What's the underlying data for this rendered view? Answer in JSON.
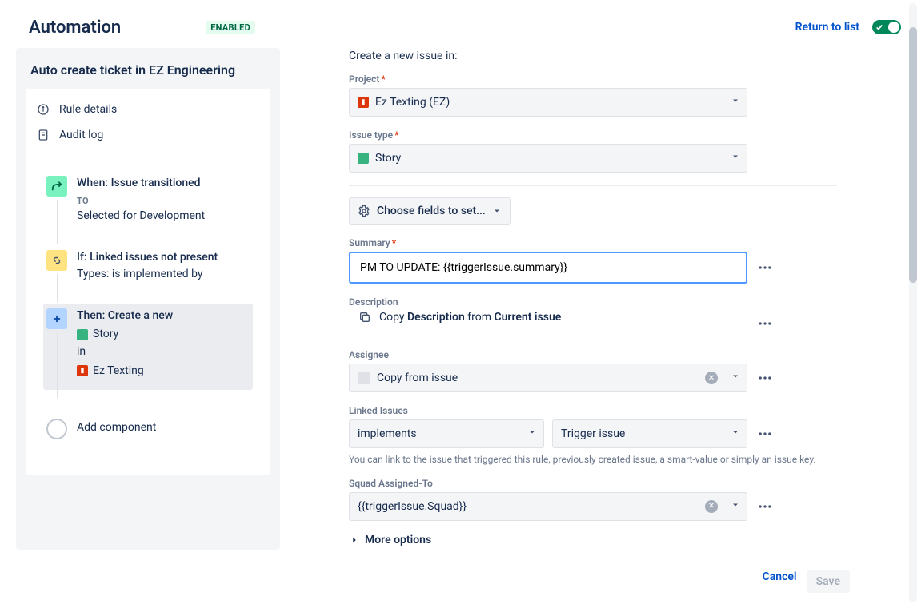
{
  "header": {
    "title": "Automation",
    "enabled_badge": "ENABLED",
    "return_label": "Return to list",
    "toggle_on": true
  },
  "rule": {
    "title": "Auto create ticket in EZ Engineering",
    "menu": {
      "details": "Rule details",
      "audit": "Audit log"
    },
    "steps": {
      "trigger": {
        "label": "When: Issue transitioned",
        "sub": "TO",
        "value": "Selected for Development"
      },
      "condition": {
        "label": "If: Linked issues not present",
        "value": "Types: is implemented by"
      },
      "action": {
        "label": "Then: Create a new",
        "issuetype": "Story",
        "in": "in",
        "project": "Ez Texting"
      }
    },
    "add_component": "Add component"
  },
  "form": {
    "heading": "Create a new issue in:",
    "project_label": "Project",
    "project_value": "Ez Texting (EZ)",
    "issuetype_label": "Issue type",
    "issuetype_value": "Story",
    "choose_fields": "Choose fields to set...",
    "summary_label": "Summary",
    "summary_value": "PM TO UPDATE: {{triggerIssue.summary}}",
    "description_label": "Description",
    "copy_desc_prefix": "Copy ",
    "copy_desc_field": "Description",
    "copy_desc_mid": " from ",
    "copy_desc_source": "Current issue",
    "assignee_label": "Assignee",
    "assignee_value": "Copy from issue",
    "linked_label": "Linked Issues",
    "link_type": "implements",
    "link_target": "Trigger issue",
    "linked_help": "You can link to the issue that triggered this rule, previously created issue, a smart-value or simply an issue key.",
    "squad_label": "Squad Assigned-To",
    "squad_value": "{{triggerIssue.Squad}}",
    "more_options": "More options",
    "cancel": "Cancel",
    "save": "Save"
  }
}
